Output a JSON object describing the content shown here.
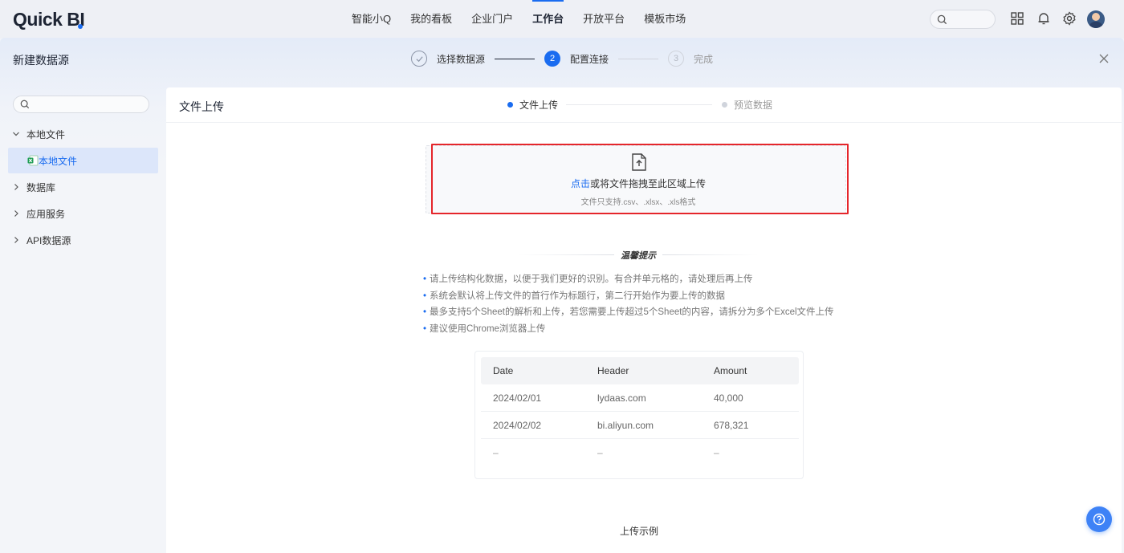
{
  "app": {
    "logo_main": "Quick B",
    "logo_tail": "I"
  },
  "nav": [
    {
      "label": "智能小Q",
      "active": false
    },
    {
      "label": "我的看板",
      "active": false
    },
    {
      "label": "企业门户",
      "active": false
    },
    {
      "label": "工作台",
      "active": true
    },
    {
      "label": "开放平台",
      "active": false
    },
    {
      "label": "模板市场",
      "active": false
    }
  ],
  "top_icons": [
    "search-icon",
    "apps-grid-icon",
    "bell-icon",
    "gear-icon",
    "avatar"
  ],
  "modal": {
    "title": "新建数据源",
    "steps": [
      {
        "index": "1",
        "label": "选择数据源",
        "state": "done"
      },
      {
        "index": "2",
        "label": "配置连接",
        "state": "active"
      },
      {
        "index": "3",
        "label": "完成",
        "state": "todo"
      }
    ]
  },
  "sidebar": {
    "search_placeholder": "",
    "items": [
      {
        "label": "本地文件",
        "type": "group",
        "expanded": true
      },
      {
        "label": "本地文件",
        "type": "leaf",
        "selected": true,
        "icon": "excel-file-icon"
      },
      {
        "label": "数据库",
        "type": "group",
        "expanded": false
      },
      {
        "label": "应用服务",
        "type": "group",
        "expanded": false
      },
      {
        "label": "API数据源",
        "type": "group",
        "expanded": false
      }
    ]
  },
  "main": {
    "title": "文件上传",
    "sub_steps": [
      {
        "label": "文件上传",
        "active": true
      },
      {
        "label": "预览数据",
        "active": false
      }
    ],
    "dropzone": {
      "link_text": "点击",
      "text": "或将文件拖拽至此区域上传",
      "hint": "文件只支持.csv、.xlsx、.xls格式"
    },
    "tips_title": "温馨提示",
    "tips": [
      "请上传结构化数据，以便于我们更好的识别。有合并单元格的，请处理后再上传",
      "系统会默认将上传文件的首行作为标题行，第二行开始作为要上传的数据",
      "最多支持5个Sheet的解析和上传，若您需要上传超过5个Sheet的内容，请拆分为多个Excel文件上传",
      "建议使用Chrome浏览器上传"
    ],
    "sample_table": {
      "headers": [
        "Date",
        "Header",
        "Amount"
      ],
      "rows": [
        [
          "2024/02/01",
          "lydaas.com",
          "40,000"
        ],
        [
          "2024/02/02",
          "bi.aliyun.com",
          "678,321"
        ],
        [
          "–",
          "–",
          "–"
        ]
      ],
      "caption": "上传示例"
    }
  },
  "colors": {
    "accent": "#1a6cf0",
    "highlight_box": "#e5262b",
    "selected_bg": "#dce6fa"
  }
}
